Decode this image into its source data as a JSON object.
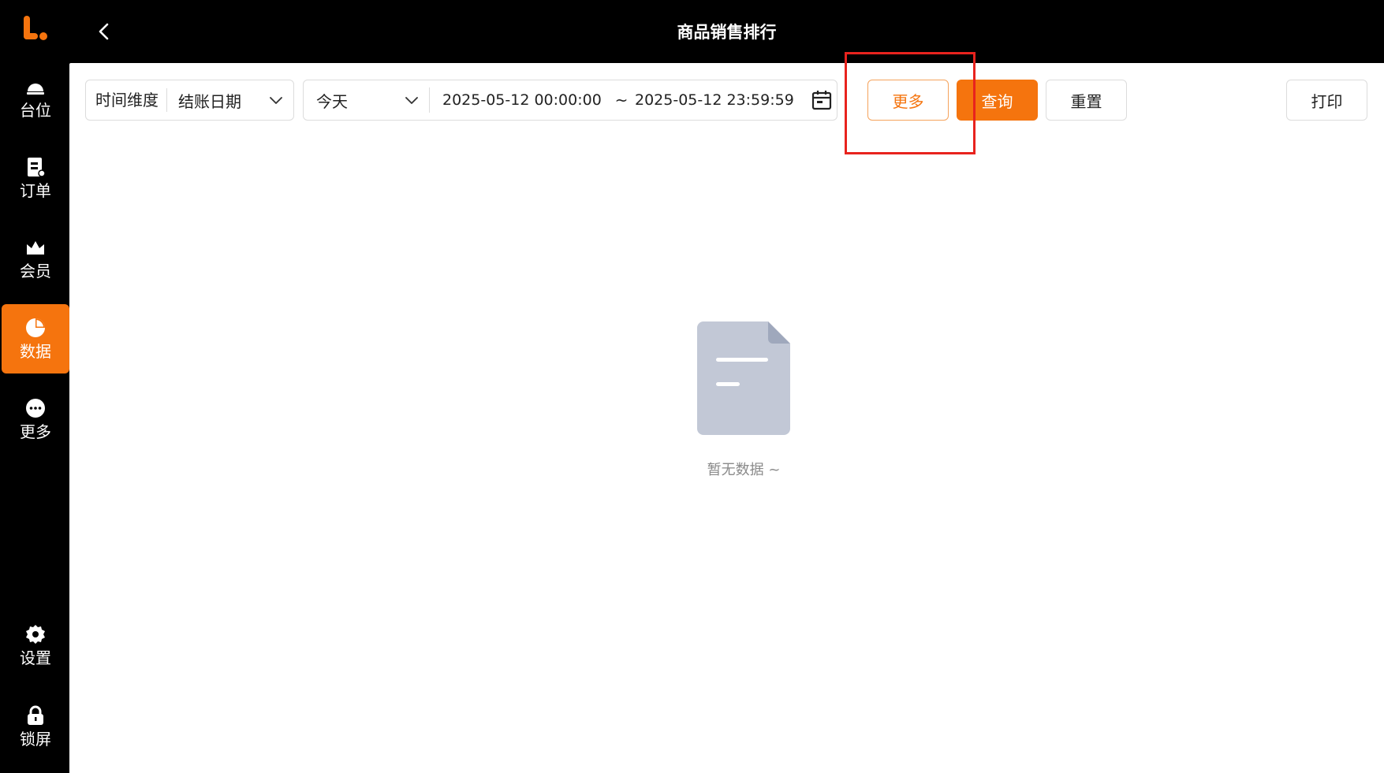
{
  "sidebar": {
    "items": [
      {
        "label": "台位",
        "icon": "table-bell-icon"
      },
      {
        "label": "订单",
        "icon": "order-doc-icon"
      },
      {
        "label": "会员",
        "icon": "member-crown-icon"
      },
      {
        "label": "数据",
        "icon": "pie-chart-icon",
        "active": true
      },
      {
        "label": "更多",
        "icon": "more-dots-icon"
      },
      {
        "label": "设置",
        "icon": "gear-icon"
      },
      {
        "label": "锁屏",
        "icon": "lock-icon"
      }
    ]
  },
  "header": {
    "title": "商品销售排行"
  },
  "filters": {
    "time_dimension_label": "时间维度",
    "time_dimension_value": "结账日期",
    "period_value": "今天",
    "date_start": "2025-05-12 00:00:00",
    "date_separator": "~",
    "date_end": "2025-05-12 23:59:59"
  },
  "actions": {
    "more_label": "更多",
    "query_label": "查询",
    "reset_label": "重置",
    "print_label": "打印"
  },
  "empty": {
    "text": "暂无数据 ~"
  },
  "colors": {
    "accent": "#f5740e",
    "highlight": "#e8231e"
  }
}
